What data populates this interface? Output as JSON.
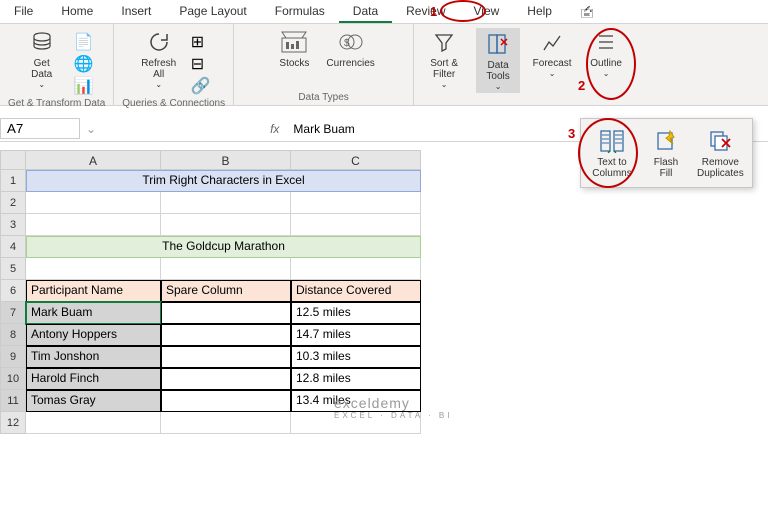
{
  "tabs": {
    "file": "File",
    "home": "Home",
    "insert": "Insert",
    "pagelayout": "Page Layout",
    "formulas": "Formulas",
    "data": "Data",
    "review": "Review",
    "view": "View",
    "help": "Help"
  },
  "ribbon": {
    "getdata": "Get\nData",
    "refreshall": "Refresh\nAll",
    "stocks": "Stocks",
    "currencies": "Currencies",
    "sortfilter": "Sort &\nFilter",
    "datatools": "Data\nTools",
    "forecast": "Forecast",
    "outline": "Outline",
    "g1": "Get & Transform Data",
    "g2": "Queries & Connections",
    "g3": "Data Types"
  },
  "popup": {
    "texttocolumns": "Text to\nColumns",
    "flashfill": "Flash\nFill",
    "removedups": "Remove\nDuplicates"
  },
  "annotations": {
    "n1": "1",
    "n2": "2",
    "n3": "3"
  },
  "fbar": {
    "ref": "A7",
    "fx": "fx",
    "val": "Mark Buam"
  },
  "cols": {
    "A": "A",
    "B": "B",
    "C": "C"
  },
  "rows": {
    "r1": "1",
    "r2": "2",
    "r3": "3",
    "r4": "4",
    "r5": "5",
    "r6": "6",
    "r7": "7",
    "r8": "8",
    "r9": "9",
    "r10": "10",
    "r11": "11",
    "r12": "12"
  },
  "cells": {
    "title": "Trim Right Characters in Excel",
    "subtitle": "The Goldcup Marathon",
    "h1": "Participant Name",
    "h2": "Spare Column",
    "h3": "Distance Covered",
    "data": [
      {
        "name": "Mark Buam",
        "spare": "",
        "dist": "12.5 miles"
      },
      {
        "name": "Antony Hoppers",
        "spare": "",
        "dist": "14.7 miles"
      },
      {
        "name": "Tim Jonshon",
        "spare": "",
        "dist": "10.3 miles"
      },
      {
        "name": "Harold Finch",
        "spare": "",
        "dist": "12.8 miles"
      },
      {
        "name": "Tomas Gray",
        "spare": "",
        "dist": "13.4 miles"
      }
    ]
  },
  "watermark": {
    "main": "exceldemy",
    "sub": "EXCEL · DATA · BI"
  }
}
